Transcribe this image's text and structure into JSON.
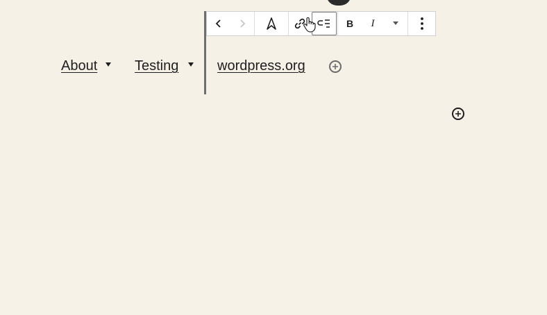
{
  "navigation": {
    "items": [
      {
        "label": "About"
      },
      {
        "label": "Testing"
      },
      {
        "label": "wordpress.org"
      }
    ]
  },
  "toolbar": {
    "buttons": [
      {
        "name": "previous",
        "icon": "chevron-left-icon"
      },
      {
        "name": "next",
        "icon": "chevron-right-icon"
      },
      {
        "name": "navigation-link",
        "icon": "navigation-link-icon"
      },
      {
        "name": "link",
        "icon": "link-icon"
      },
      {
        "name": "add-submenu",
        "icon": "add-submenu-icon",
        "active": true
      },
      {
        "name": "bold",
        "icon": "bold-icon",
        "label": "B"
      },
      {
        "name": "italic",
        "icon": "italic-icon",
        "label": "I"
      },
      {
        "name": "more-rich-text",
        "icon": "caret-down-icon"
      },
      {
        "name": "options",
        "icon": "more-vertical-icon"
      }
    ]
  },
  "colors": {
    "background": "#f5f1e6",
    "text": "#1e1e1e",
    "toolbar_border": "#cfcfcf"
  }
}
